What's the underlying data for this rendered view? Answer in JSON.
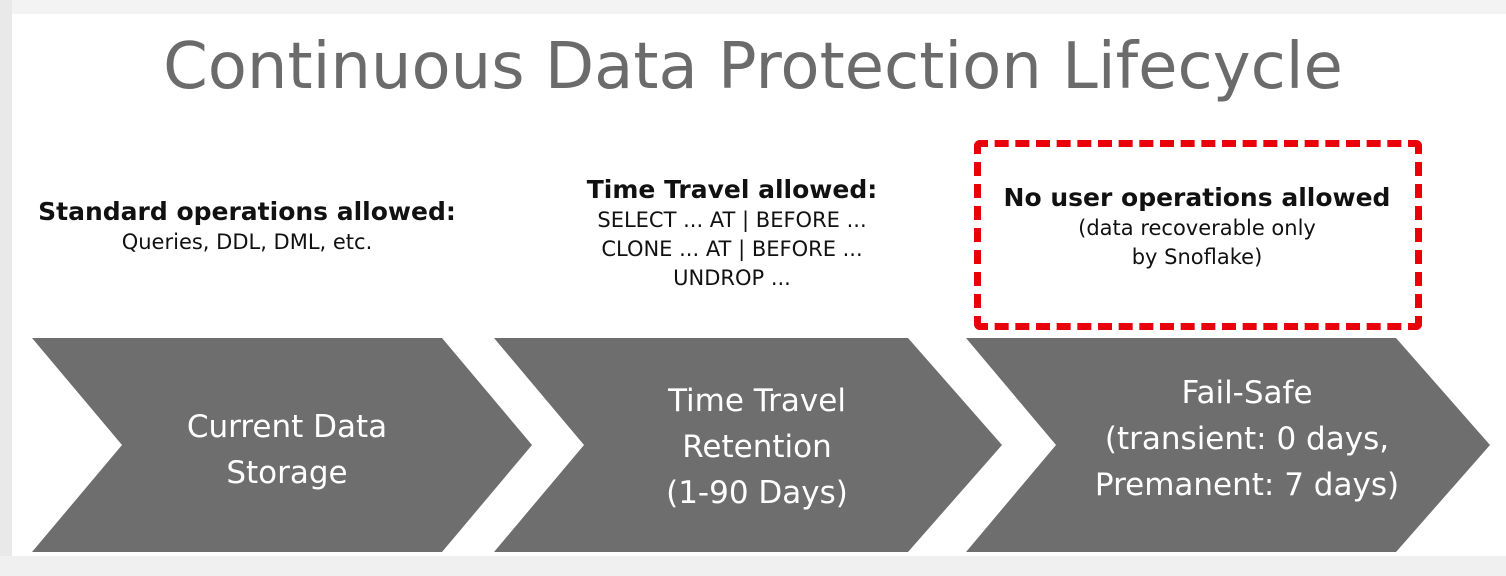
{
  "title": "Continuous Data Protection Lifecycle",
  "stages": [
    {
      "caption_head": "Standard operations allowed:",
      "caption_lines": [
        "Queries, DDL, DML, etc."
      ],
      "label_lines": [
        "Current Data",
        "Storage"
      ]
    },
    {
      "caption_head": "Time Travel allowed:",
      "caption_lines": [
        "SELECT  ... AT | BEFORE  ...",
        "CLONE  ... AT | BEFORE  ...",
        "UNDROP  ..."
      ],
      "label_lines": [
        "Time Travel",
        "Retention",
        "(1-90 Days)"
      ]
    },
    {
      "caption_head": "No user operations allowed",
      "caption_lines": [
        "(data recoverable only",
        "by Snoflake)"
      ],
      "label_lines": [
        "Fail-Safe",
        "(transient: 0 days,",
        "Premanent: 7 days)"
      ]
    }
  ],
  "colors": {
    "arrow_fill": "#6e6e6e",
    "title_text": "#6b6b6b",
    "highlight_border": "#e8000b"
  }
}
